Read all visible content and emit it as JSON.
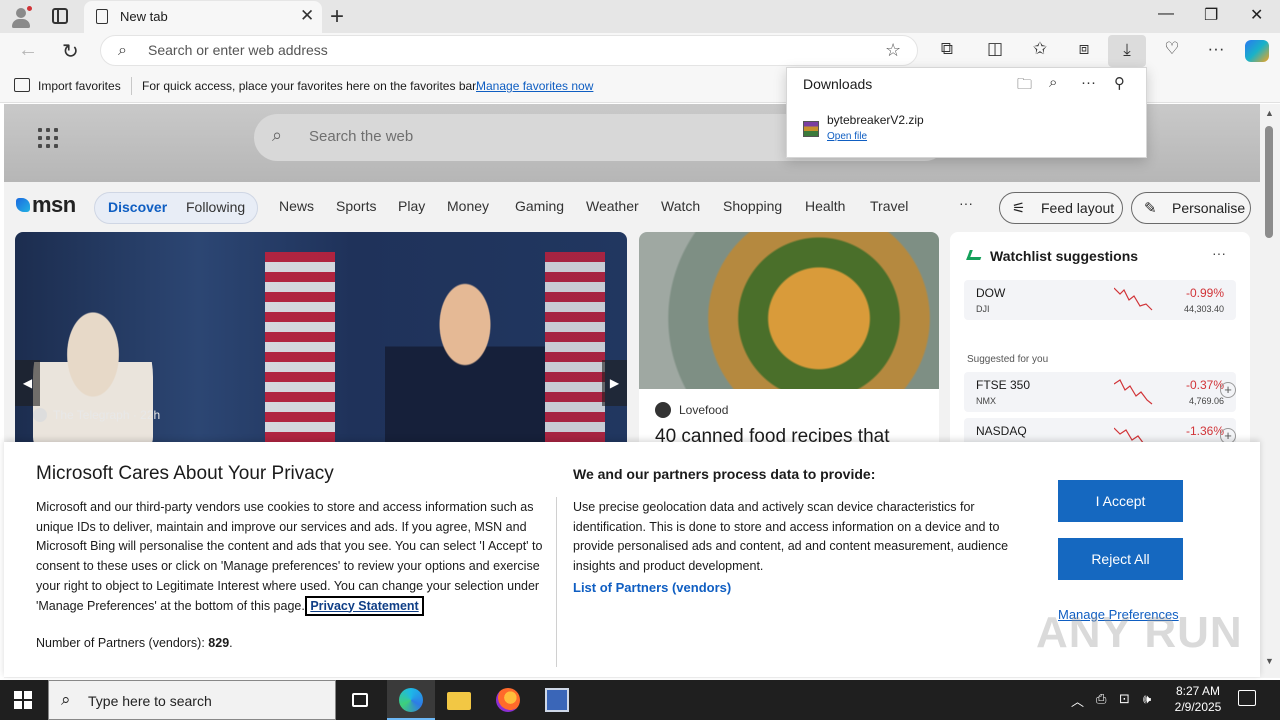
{
  "browser": {
    "tab_title": "New tab",
    "address_placeholder": "Search or enter web address"
  },
  "favorites_bar": {
    "import_label": "Import favorites",
    "message": "For quick access, place your favorites here on the favorites bar.",
    "manage_link": "Manage favorites now"
  },
  "downloads": {
    "title": "Downloads",
    "file_name": "bytebreakerV2.zip",
    "open_label": "Open file"
  },
  "msn": {
    "logo": "msn",
    "search_placeholder": "Search the web",
    "nav": {
      "discover": "Discover",
      "following": "Following",
      "categories": [
        "News",
        "Sports",
        "Play",
        "Money",
        "Gaming",
        "Weather",
        "Watch",
        "Shopping",
        "Health",
        "Travel"
      ],
      "more": "···",
      "feed_layout": "Feed layout",
      "personalise": "Personalise"
    },
    "hero_card": {
      "source": "The Telegraph",
      "age": "22h"
    },
    "food_card": {
      "source": "Lovefood",
      "headline": "40 canned food recipes that"
    },
    "watchlist": {
      "title": "Watchlist suggestions",
      "menu": "···",
      "suggested_label": "Suggested for you",
      "stocks": [
        {
          "symbol": "DOW",
          "exchange": "DJI",
          "change": "-0.99%",
          "price": "44,303.40"
        },
        {
          "symbol": "FTSE 350",
          "exchange": "NMX",
          "change": "-0.37%",
          "price": "4,769.06"
        },
        {
          "symbol": "NASDAQ",
          "exchange": "",
          "change": "-1.36%",
          "price": ""
        }
      ]
    }
  },
  "consent": {
    "title": "Microsoft Cares About Your Privacy",
    "body": "Microsoft and our third-party vendors use cookies to store and access information such as unique IDs to deliver, maintain and improve our services and ads. If you agree, MSN and Microsoft Bing will personalise the content and ads that you see. You can select 'I Accept' to consent to these uses or click on 'Manage preferences' to review your options and exercise your right to object to Legitimate Interest where used.  You can change your selection under 'Manage Preferences' at the bottom of this page.",
    "privacy_link": "Privacy Statement",
    "partners_label": "Number of Partners (vendors):",
    "partners_count": "829",
    "partners_suffix": ".",
    "right_title": "We and our partners process data to provide:",
    "right_body": "Use precise geolocation data and actively scan device characteristics for identification. This is done to store and access information on a device and to provide personalised ads and content, ad and content measurement, audience insights and product development.",
    "list_link": "List of Partners (vendors)",
    "accept": "I Accept",
    "reject": "Reject All",
    "manage": "Manage Preferences"
  },
  "taskbar": {
    "search_placeholder": "Type here to search",
    "time": "8:27 AM",
    "date": "2/9/2025"
  },
  "watermark": "ANY RUN",
  "colors": {
    "accent": "#1568c0",
    "link": "#0f5ec2",
    "negative": "#d13438",
    "taskbar": "#1f1f1f"
  }
}
